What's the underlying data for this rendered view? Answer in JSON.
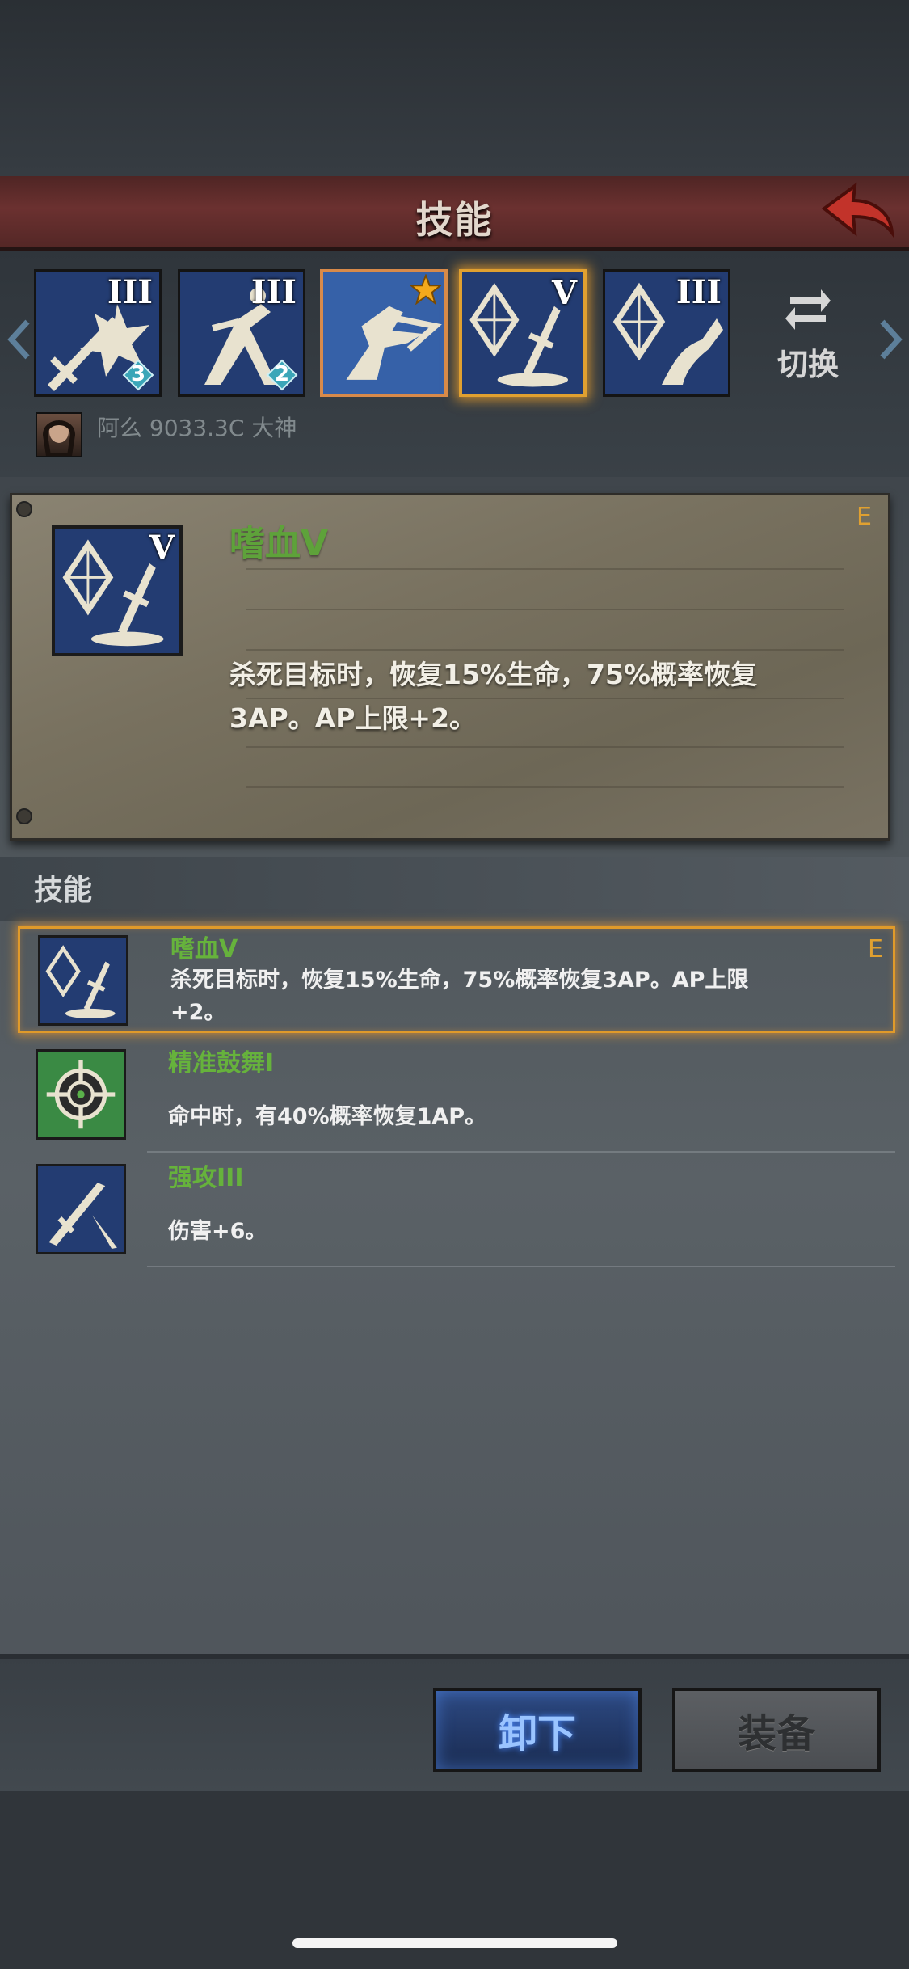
{
  "header": {
    "title": "技能",
    "back_icon": "back-arrow-icon"
  },
  "skill_bar": {
    "slots": [
      {
        "level": "III",
        "badge": "3",
        "icon": "sword-explosion-icon"
      },
      {
        "level": "III",
        "badge": "2",
        "icon": "acrobat-icon"
      },
      {
        "level": "",
        "badge": "",
        "star": true,
        "icon": "dash-strike-icon"
      },
      {
        "level": "V",
        "badge": "",
        "icon": "crystal-sword-icon"
      },
      {
        "level": "III",
        "badge": "",
        "icon": "crystal-heal-icon"
      }
    ],
    "switch_label": "切换",
    "user_name": "阿么 9033.3C 大神"
  },
  "detail": {
    "name": "嗜血V",
    "grade": "E",
    "icon_level": "V",
    "description": "杀死目标时，恢复15%生命，75%概率恢复3AP。AP上限+2。"
  },
  "skills_section": {
    "title": "技能",
    "items": [
      {
        "name": "嗜血V",
        "description": "杀死目标时，恢复15%生命，75%概率恢复3AP。AP上限+2。",
        "grade": "E"
      },
      {
        "name": "精准鼓舞I",
        "description": "命中时，有40%概率恢复1AP。",
        "grade": ""
      },
      {
        "name": "强攻III",
        "description": "伤害+6。",
        "grade": ""
      }
    ]
  },
  "buttons": {
    "unequip": "卸下",
    "equip": "装备"
  },
  "colors": {
    "skill_name": "#66b23c",
    "grade": "#e0a030",
    "banner": "#6b3130",
    "selected_glow": "#e09a2a"
  }
}
